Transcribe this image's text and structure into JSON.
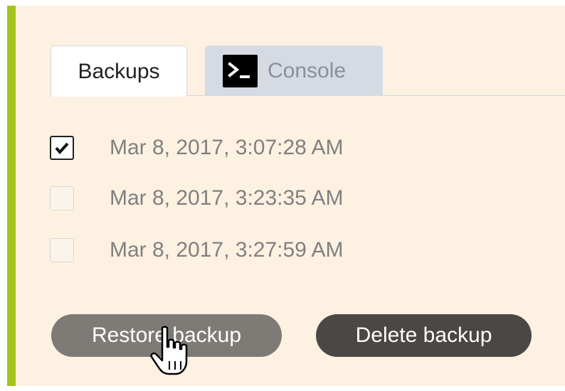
{
  "tabs": {
    "backups_label": "Backups",
    "console_label": "Console",
    "active": "Backups"
  },
  "backups": {
    "items": [
      {
        "label": "Mar 8, 2017, 3:07:28 AM",
        "checked": true
      },
      {
        "label": "Mar 8, 2017, 3:23:35 AM",
        "checked": false
      },
      {
        "label": "Mar 8, 2017, 3:27:59 AM",
        "checked": false
      }
    ]
  },
  "actions": {
    "restore_label": "Restore backup",
    "delete_label": "Delete backup"
  },
  "icons": {
    "console": "terminal-prompt-icon",
    "cursor": "hand-pointer-icon",
    "check": "checkmark-icon"
  },
  "colors": {
    "accent": "#a6c51c",
    "panel_background": "#fdf1e2",
    "restore_button": "#7e7b77",
    "delete_button": "#4a4744"
  }
}
